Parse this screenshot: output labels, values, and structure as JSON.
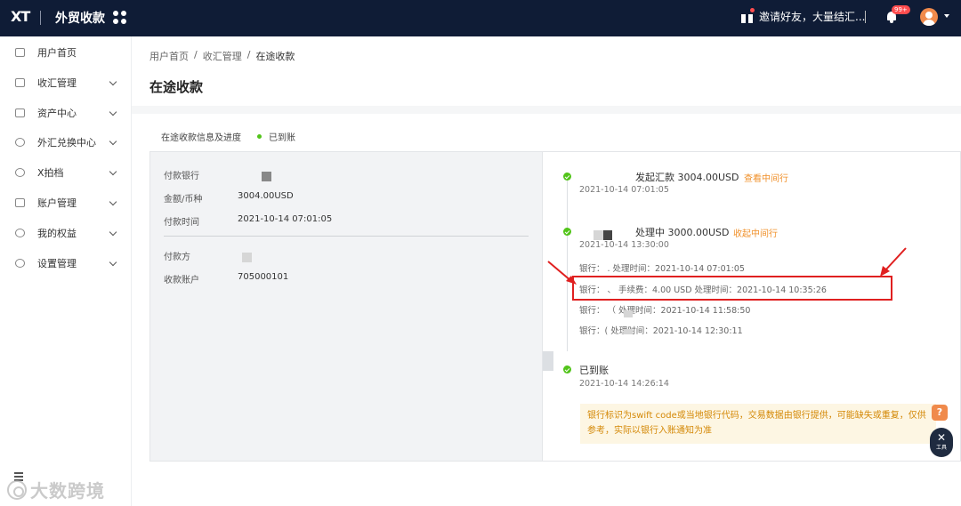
{
  "topbar": {
    "logo": "XT",
    "app_title": "外贸收款",
    "invite_text": "邀请好友，大量结汇...",
    "notification_badge": "99+"
  },
  "sidebar": {
    "items": [
      {
        "label": "用户首页",
        "icon": "dashboard-icon",
        "expandable": false
      },
      {
        "label": "收汇管理",
        "icon": "receive-icon",
        "expandable": true
      },
      {
        "label": "资产中心",
        "icon": "wallet-icon",
        "expandable": true
      },
      {
        "label": "外汇兑换中心",
        "icon": "exchange-icon",
        "expandable": true
      },
      {
        "label": "X拍档",
        "icon": "partner-icon",
        "expandable": true
      },
      {
        "label": "账户管理",
        "icon": "account-icon",
        "expandable": true
      },
      {
        "label": "我的权益",
        "icon": "user-icon",
        "expandable": true
      },
      {
        "label": "设置管理",
        "icon": "settings-icon",
        "expandable": true
      }
    ]
  },
  "breadcrumb": [
    "用户首页",
    "/",
    "收汇管理",
    "/",
    "在途收款"
  ],
  "page_title": "在途收款",
  "section": {
    "title": "在途收款信息及进度",
    "status": "已到账",
    "status_color": "#52c41a"
  },
  "payment_info": {
    "bank_label": "付款银行",
    "amount_label": "金额/币种",
    "amount_value": "3004.00USD",
    "time_label": "付款时间",
    "time_value": "2021-10-14 07:01:05",
    "payer_label": "付款方",
    "account_label": "收款账户",
    "account_value": "705000101"
  },
  "timeline": [
    {
      "title": "发起汇款 3004.00USD",
      "time": "2021-10-14 07:01:05",
      "link": "查看中间行"
    },
    {
      "title": "处理中 3000.00USD",
      "time": "2021-10-14 13:30:00",
      "link": "收起中间行",
      "details": [
        "银行：                 .    处理时间：2021-10-14 07:01:05",
        "银行：                  、  手续费：4.00 USD    处理时间：2021-10-14 10:35:26",
        "银行：                   （    处理时间：2021-10-14 11:58:50",
        "银行：(                          处理时间：2021-10-14 12:30:11"
      ]
    },
    {
      "title": "已到账",
      "time": "2021-10-14 14:26:14"
    }
  ],
  "notice": "银行标识为swift code或当地银行代码，交易数据由银行提供，可能缺失或重复，仅供参考，实际以银行入账通知为准",
  "floating": {
    "help": "?",
    "tool_label": "工具"
  },
  "watermark": "大数跨境",
  "colors": {
    "topbar": "#0f1c36",
    "accent": "#f0902a",
    "success": "#52c41a",
    "highlight": "#e02020"
  }
}
